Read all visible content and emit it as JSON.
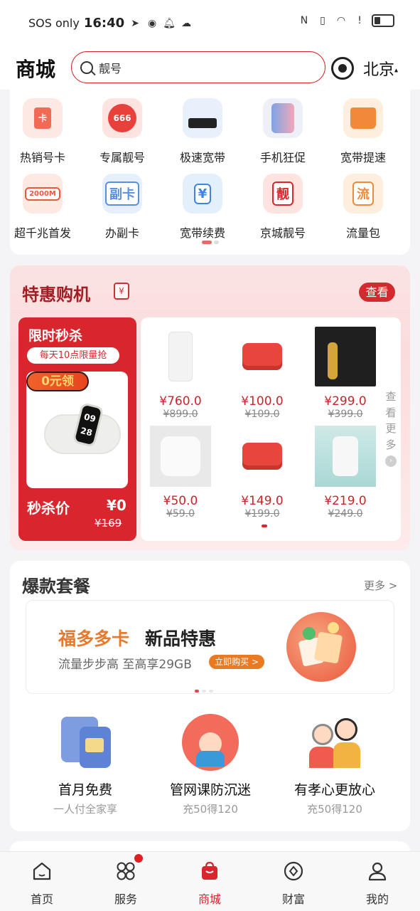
{
  "status_bar": {
    "carrier": "SOS only",
    "time": "16:40",
    "left_icons": [
      "telegram-icon",
      "discord-icon",
      "bell-icon",
      "cloud-icon"
    ],
    "right_icons": [
      "nfc-icon",
      "vibrate-icon",
      "wifi-icon",
      "alert-icon",
      "battery-icon"
    ]
  },
  "header": {
    "title": "商城",
    "search_placeholder": "靓号",
    "city": "北京",
    "city_arrow": "▴"
  },
  "grid": [
    {
      "label": "热销号卡",
      "icon": "sim-card-icon",
      "color": "#f06a55",
      "bg": "#fde8e4"
    },
    {
      "label": "专属靓号",
      "icon": "badge-666-icon",
      "color": "#e8413c",
      "bg": "#fde4e0"
    },
    {
      "label": "极速宽带",
      "icon": "router-icon",
      "color": "#333333",
      "bg": "#e8f0fb"
    },
    {
      "label": "手机狂促",
      "icon": "phone-icon",
      "color": "#5a8fd8",
      "bg": "#eef0f8"
    },
    {
      "label": "宽带提速",
      "icon": "house-icon",
      "color": "#f08a3a",
      "bg": "#fdeedd"
    },
    {
      "label": "超千兆首发",
      "icon": "monitor-icon",
      "color": "#e9573c",
      "bg": "#fde8e2",
      "text": "2000M"
    },
    {
      "label": "办副卡",
      "icon": "sub-card-icon",
      "color": "#5a8fe0",
      "bg": "#e6effc",
      "text": "副卡"
    },
    {
      "label": "宽带续费",
      "icon": "ticket-icon",
      "color": "#3b85e6",
      "bg": "#e4effc",
      "text": "¥"
    },
    {
      "label": "京城靓号",
      "icon": "liang-badge-icon",
      "color": "#d9252d",
      "bg": "#fde4e0",
      "text": "靓"
    },
    {
      "label": "流量包",
      "icon": "tag-icon",
      "color": "#f08a3a",
      "bg": "#fdeedd",
      "text": "流"
    }
  ],
  "grid_icon_text": {
    "hot": "卡",
    "vip": "666"
  },
  "tehui": {
    "title": "特惠购机",
    "badge": "¥",
    "look_label": "查看",
    "flash": {
      "title": "限时秒杀",
      "subtitle": "每天10点限量抢",
      "tag": "0元领",
      "watch_time": "09 28",
      "price_label": "秒杀价",
      "price": "¥0",
      "old_price": "¥169"
    },
    "products": [
      {
        "price": "¥760.0",
        "old": "¥899.0",
        "kind": "white-router"
      },
      {
        "price": "¥100.0",
        "old": "¥109.0",
        "kind": "red-speaker"
      },
      {
        "price": "¥299.0",
        "old": "¥399.0",
        "kind": "shaver-box"
      },
      {
        "price": "¥50.0",
        "old": "¥59.0",
        "kind": "white-speaker"
      },
      {
        "price": "¥149.0",
        "old": "¥199.0",
        "kind": "red-speaker"
      },
      {
        "price": "¥219.0",
        "old": "¥249.0",
        "kind": "camera"
      }
    ],
    "more_vertical": [
      "查",
      "看",
      "更",
      "多"
    ],
    "more_arrow": "›"
  },
  "baokuan": {
    "title": "爆款套餐",
    "more_label": "更多 >",
    "banner": {
      "title_colored": "福多多卡",
      "title_dark": "新品特惠",
      "subtitle": "流量步步高 至高享29GB",
      "button": "立即购买 >"
    },
    "features": [
      {
        "title": "首月免费",
        "subtitle": "一人付全家享",
        "icon": "sim-cards-icon"
      },
      {
        "title": "管网课防沉迷",
        "subtitle": "充50得120",
        "icon": "child-study-icon"
      },
      {
        "title": "有孝心更放心",
        "subtitle": "充50得120",
        "icon": "elderly-couple-icon"
      }
    ]
  },
  "nav": [
    {
      "label": "首页",
      "icon": "home-icon",
      "active": false
    },
    {
      "label": "服务",
      "icon": "apps-icon",
      "active": false,
      "badge": true
    },
    {
      "label": "商城",
      "icon": "shopping-bag-icon",
      "active": true
    },
    {
      "label": "财富",
      "icon": "coin-icon",
      "active": false
    },
    {
      "label": "我的",
      "icon": "user-icon",
      "active": false
    }
  ],
  "colors": {
    "brand_red": "#d9252d",
    "orange": "#e67a2e",
    "tehui_bg": "#fbe3e3"
  }
}
